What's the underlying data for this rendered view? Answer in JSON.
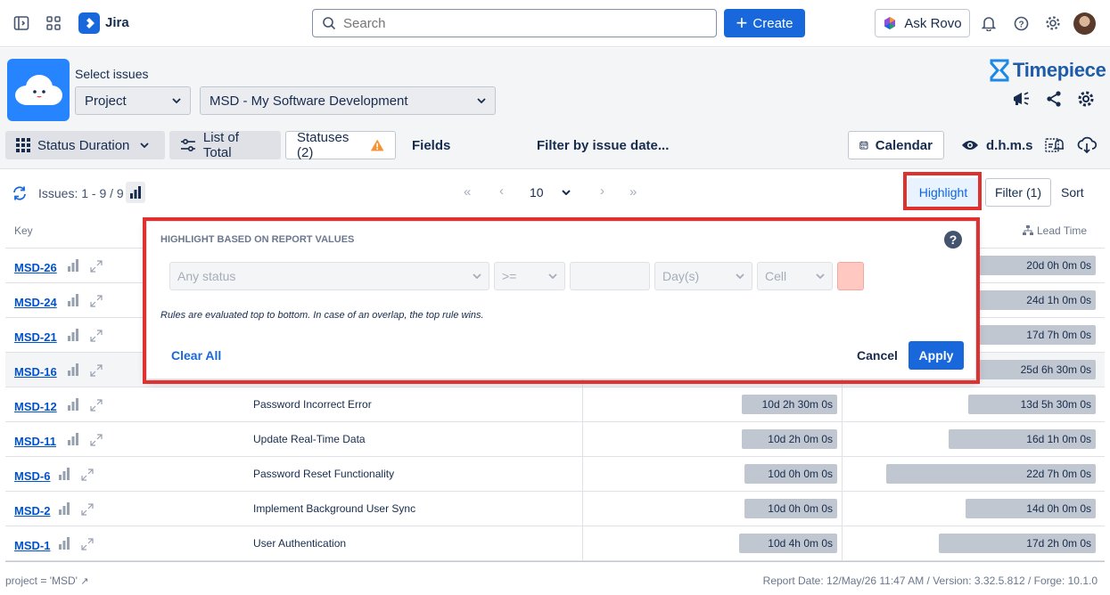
{
  "topbar": {
    "app_name": "Jira",
    "search_placeholder": "Search",
    "create_label": "Create",
    "ask_rovo_label": "Ask Rovo"
  },
  "header": {
    "select_issues_label": "Select issues",
    "scope_select": "Project",
    "project_select": "MSD - My Software Development",
    "brand": "Timepiece"
  },
  "toolbar": {
    "status_duration": "Status Duration",
    "list_of_total": "List of Total",
    "statuses": "Statuses (2)",
    "fields": "Fields",
    "filter_by_date": "Filter by issue date...",
    "calendar": "Calendar",
    "time_format": "d.h.m.s"
  },
  "issues_bar": {
    "issues_count": "Issues: 1 - 9 / 9",
    "page_size": "10",
    "highlight": "Highlight",
    "filter": "Filter (1)",
    "sort": "Sort"
  },
  "table": {
    "col_key": "Key",
    "col_lead_time": "Lead Time",
    "rows": [
      {
        "key": "MSD-26",
        "summary": "",
        "dur1": "",
        "dur2": "20d 0h 0m 0s",
        "d1": 0,
        "d2": 0.53
      },
      {
        "key": "MSD-24",
        "summary": "",
        "dur1": "",
        "dur2": "24d 1h 0m 0s",
        "d1": 0,
        "d2": 0.54
      },
      {
        "key": "MSD-21",
        "summary": "",
        "dur1": "",
        "dur2": "17d 7h 0m 0s",
        "d1": 0,
        "d2": 0.54
      },
      {
        "key": "MSD-16",
        "summary": "",
        "dur1": "",
        "dur2": "25d 6h 30m 0s",
        "d1": 0,
        "d2": 0.59
      },
      {
        "key": "MSD-12",
        "summary": "Password Incorrect Error",
        "dur1": "10d 2h 30m 0s",
        "dur2": "13d 5h 30m 0s",
        "d1": 0.37,
        "d2": 0.51
      },
      {
        "key": "MSD-11",
        "summary": "Update Real-Time Data",
        "dur1": "10d 2h 0m 0s",
        "dur2": "16d 1h 0m 0s",
        "d1": 0.37,
        "d2": 0.59
      },
      {
        "key": "MSD-6",
        "summary": "Password Reset Functionality",
        "dur1": "10d 0h 0m 0s",
        "dur2": "22d 7h 0m 0s",
        "d1": 0.36,
        "d2": 0.84
      },
      {
        "key": "MSD-2",
        "summary": "Implement Background User Sync",
        "dur1": "10d 0h 0m 0s",
        "dur2": "14d 0h 0m 0s",
        "d1": 0.36,
        "d2": 0.52
      },
      {
        "key": "MSD-1",
        "summary": "User Authentication",
        "dur1": "10d 4h 0m 0s",
        "dur2": "17d 2h 0m 0s",
        "d1": 0.38,
        "d2": 0.63
      }
    ]
  },
  "popup": {
    "title": "HIGHLIGHT BASED ON REPORT VALUES",
    "status_placeholder": "Any status",
    "operator": ">=",
    "unit": "Day(s)",
    "target": "Cell",
    "note": "Rules are evaluated top to bottom. In case of an overlap, the top rule wins.",
    "clear_all": "Clear All",
    "cancel": "Cancel",
    "apply": "Apply",
    "swatch_color": "#ffc9c2"
  },
  "footer": {
    "jql": "project = 'MSD'",
    "report_info": "Report Date: 12/May/26 11:47 AM / Version: 3.32.5.812 / Forge: 10.1.0"
  },
  "colors": {
    "accent": "#1868db",
    "highlight_frame": "#e03131"
  }
}
